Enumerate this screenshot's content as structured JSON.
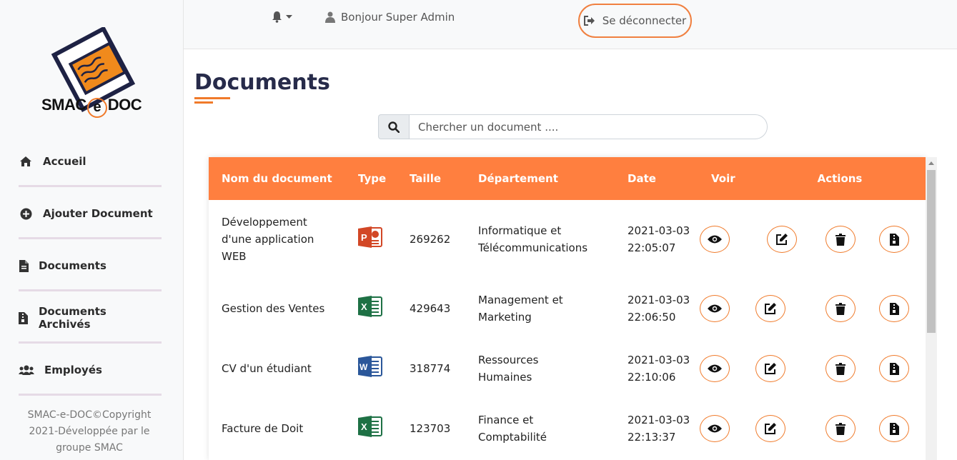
{
  "sidebar": {
    "logo_text": "SMAC-e-DOC",
    "logo_left": "SMAC",
    "logo_e": "e",
    "logo_right": "DOC",
    "items": [
      {
        "label": "Accueil",
        "icon": "home-icon"
      },
      {
        "label": "Ajouter Document",
        "icon": "plus-circle-icon"
      },
      {
        "label": "Documents",
        "icon": "file-icon"
      },
      {
        "label": "Documents Archivés",
        "icon": "file-archive-icon"
      },
      {
        "label": "Employés",
        "icon": "users-icon"
      }
    ],
    "copyright": "SMAC-e-DOC©Copyright 2021-Développée par le groupe SMAC"
  },
  "header": {
    "notifications_icon": "bell-icon",
    "greeting": "Bonjour Super Admin",
    "logout_label": "Se déconnecter"
  },
  "main": {
    "title": "Documents",
    "search": {
      "placeholder": "Chercher un document ...."
    },
    "table": {
      "columns": [
        "Nom du document",
        "Type",
        "Taille",
        "Département",
        "Date",
        "Voir",
        "Actions"
      ],
      "rows": [
        {
          "name": "Développement d'une application WEB",
          "type": "powerpoint",
          "size": "269262",
          "department": "Informatique et Télécommunications",
          "date": "2021-03-03 22:05:07"
        },
        {
          "name": "Gestion des Ventes",
          "type": "excel",
          "size": "429643",
          "department": "Management et Marketing",
          "date": "2021-03-03 22:06:50"
        },
        {
          "name": "CV d'un étudiant",
          "type": "word",
          "size": "318774",
          "department": "Ressources Humaines",
          "date": "2021-03-03 22:10:06"
        },
        {
          "name": "Facture de Doit",
          "type": "excel",
          "size": "123703",
          "department": "Finance et Comptabilité",
          "date": "2021-03-03 22:13:37"
        }
      ]
    }
  },
  "colors": {
    "accent": "#ff7f3f",
    "title": "#272b4a",
    "sidebar_bg": "#f8f9fa"
  }
}
